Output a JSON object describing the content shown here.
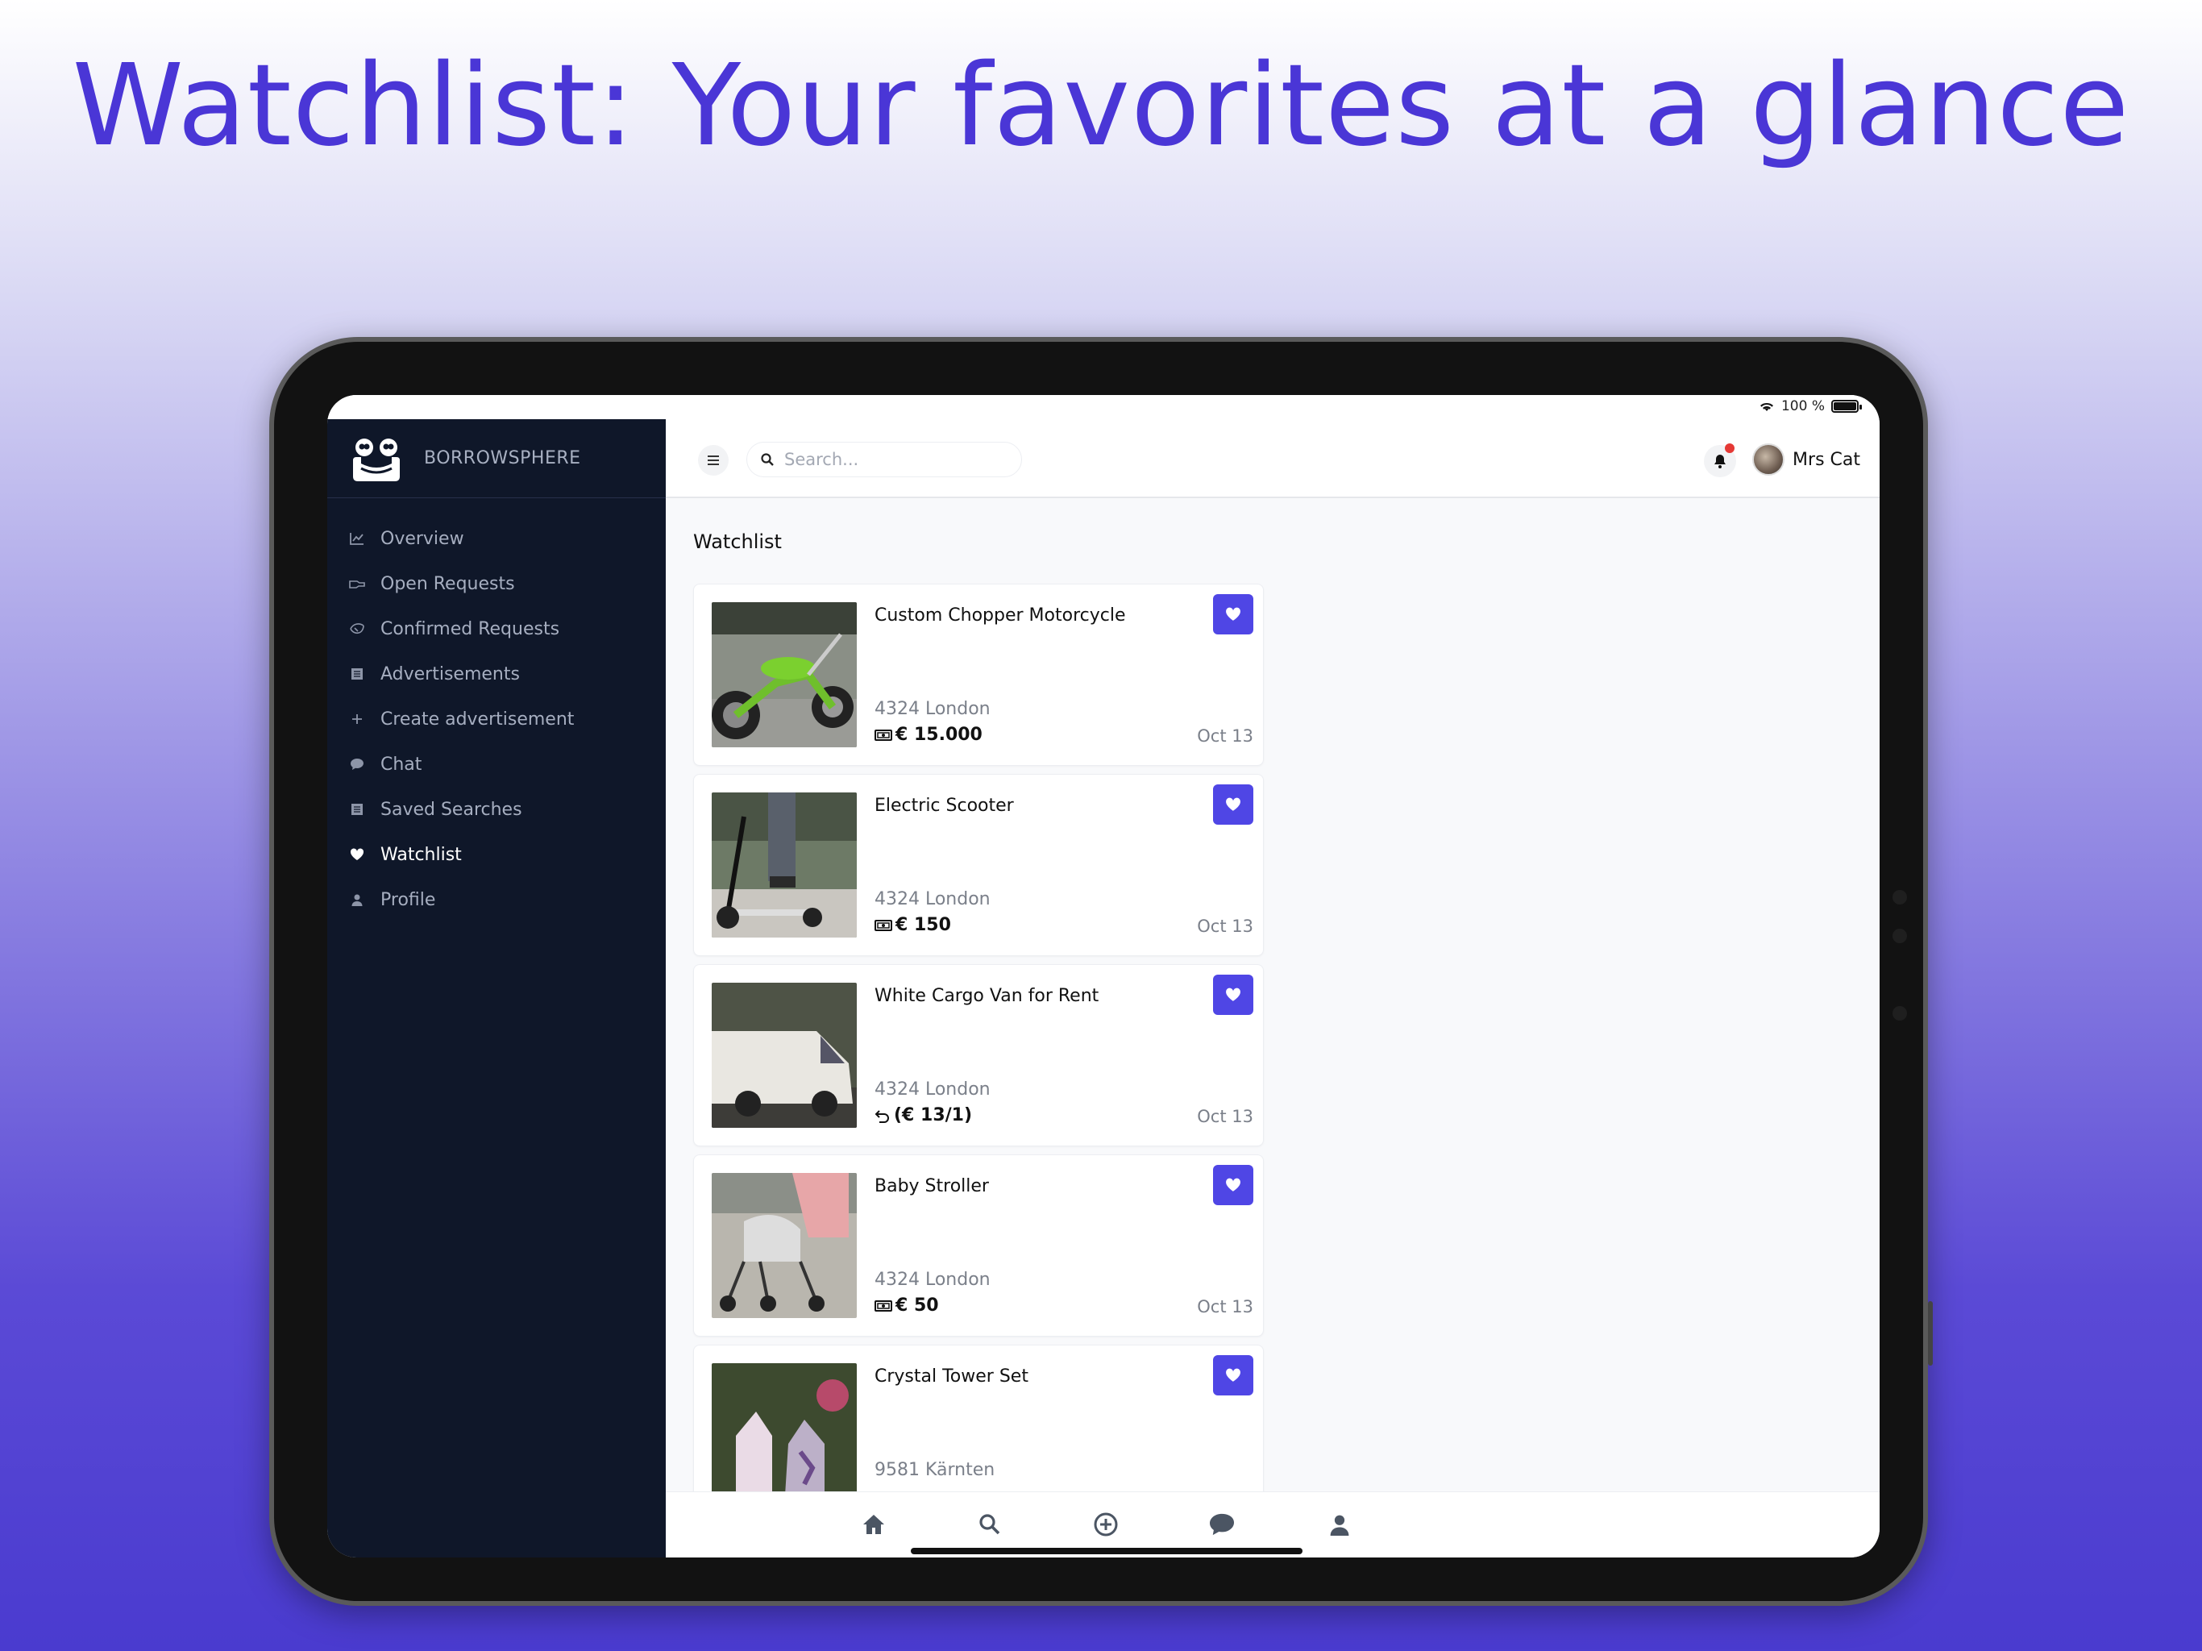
{
  "headline": "Watchlist: Your favorites at a glance",
  "statusbar": {
    "battery": "100 %"
  },
  "brand": {
    "name": "BORROWSPHERE"
  },
  "sidebar": {
    "items": [
      {
        "label": "Overview",
        "icon": "chart-line-icon"
      },
      {
        "label": "Open Requests",
        "icon": "hand-icon"
      },
      {
        "label": "Confirmed Requests",
        "icon": "handshake-icon"
      },
      {
        "label": "Advertisements",
        "icon": "list-icon"
      },
      {
        "label": "Create advertisement",
        "icon": "plus-icon"
      },
      {
        "label": "Chat",
        "icon": "chat-bubble-icon"
      },
      {
        "label": "Saved Searches",
        "icon": "list-icon"
      },
      {
        "label": "Watchlist",
        "icon": "heart-icon",
        "active": true
      },
      {
        "label": "Profile",
        "icon": "person-icon"
      }
    ]
  },
  "topbar": {
    "search_placeholder": "Search...",
    "user_name": "Mrs Cat"
  },
  "main": {
    "title": "Watchlist",
    "items": [
      {
        "title": "Custom Chopper Motorcycle",
        "location": "4324 London",
        "price": "€ 15.000",
        "price_icon": "cash-icon",
        "date": "Oct 13"
      },
      {
        "title": "Electric Scooter",
        "location": "4324 London",
        "price": "€ 150",
        "price_icon": "cash-icon",
        "date": "Oct 13"
      },
      {
        "title": "White Cargo Van for Rent",
        "location": "4324 London",
        "price": "(€ 13/1)",
        "price_icon": "rental-icon",
        "date": "Oct 13"
      },
      {
        "title": "Baby Stroller",
        "location": "4324 London",
        "price": "€ 50",
        "price_icon": "cash-icon",
        "date": "Oct 13"
      },
      {
        "title": "Crystal Tower Set",
        "location": "9581 Kärnten",
        "price": "",
        "price_icon": "cash-icon",
        "date": ""
      }
    ]
  },
  "bottomnav": {
    "items": [
      "home-icon",
      "search-icon",
      "add-circle-icon",
      "chat-bubble-icon",
      "person-icon"
    ]
  },
  "colors": {
    "accent": "#4f46e5",
    "sidebar_bg": "#0f1729",
    "headline": "#4a36d6"
  }
}
